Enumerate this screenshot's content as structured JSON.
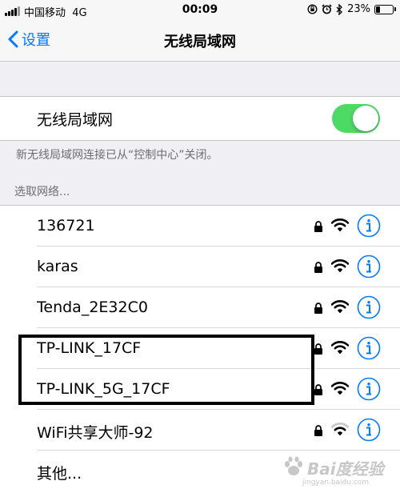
{
  "status_bar": {
    "carrier": "中国移动",
    "network": "4G",
    "time": "00:09",
    "battery": "23%",
    "battery_level": 0.23,
    "icons": [
      "signal-bars-icon",
      "orientation-lock-icon",
      "alarm-icon",
      "bluetooth-icon",
      "battery-icon"
    ]
  },
  "nav": {
    "back_label": "设置",
    "title": "无线局域网"
  },
  "wifi_toggle": {
    "label": "无线局域网",
    "enabled": true
  },
  "footnote": "新无线局域网连接已从“控制中心”关闭。",
  "section_header": "选取网络...",
  "networks": [
    {
      "name": "136721",
      "secured": true,
      "signal": "full"
    },
    {
      "name": "karas",
      "secured": true,
      "signal": "full"
    },
    {
      "name": "Tenda_2E32C0",
      "secured": true,
      "signal": "full"
    },
    {
      "name": "TP-LINK_17CF",
      "secured": true,
      "signal": "full"
    },
    {
      "name": "TP-LINK_5G_17CF",
      "secured": true,
      "signal": "full"
    },
    {
      "name": "WiFi共享大师-92",
      "secured": true,
      "signal": "medium"
    }
  ],
  "other_label": "其他...",
  "watermark": {
    "text": "Bai度经验",
    "url": "jingyan.baidu.com"
  },
  "colors": {
    "accent": "#007aff",
    "switch_on": "#4cd964",
    "background": "#efeff4"
  }
}
